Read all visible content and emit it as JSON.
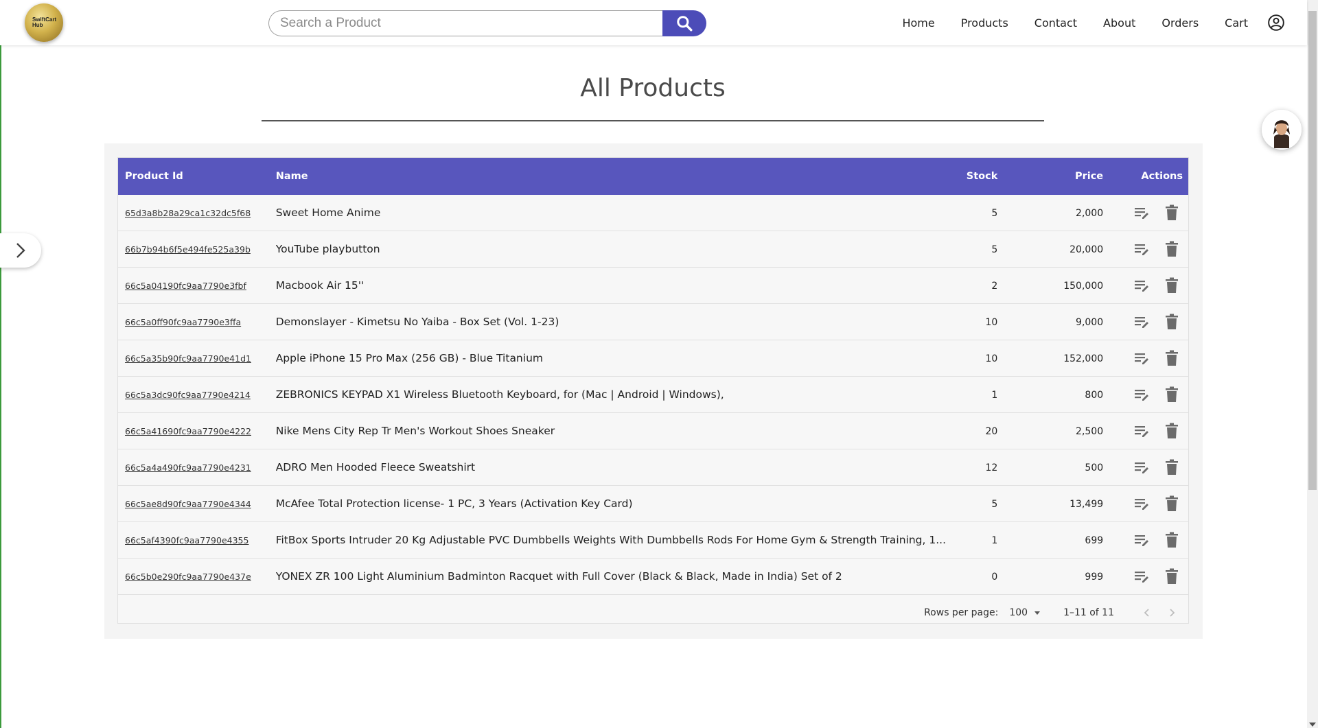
{
  "header": {
    "logo_text": "SwiftCart Hub",
    "search_placeholder": "Search a Product",
    "search_value": "",
    "nav": [
      "Home",
      "Products",
      "Contact",
      "About",
      "Orders",
      "Cart"
    ]
  },
  "page": {
    "title": "All Products"
  },
  "table": {
    "columns": {
      "id": "Product Id",
      "name": "Name",
      "stock": "Stock",
      "price": "Price",
      "actions": "Actions"
    },
    "rows": [
      {
        "id": "65d3a8b28a29ca1c32dc5f68",
        "name": "Sweet Home Anime",
        "stock": "5",
        "price": "2,000"
      },
      {
        "id": "66b7b94b6f5e494fe525a39b",
        "name": "YouTube playbutton",
        "stock": "5",
        "price": "20,000"
      },
      {
        "id": "66c5a04190fc9aa7790e3fbf",
        "name": "Macbook Air 15''",
        "stock": "2",
        "price": "150,000"
      },
      {
        "id": "66c5a0ff90fc9aa7790e3ffa",
        "name": "Demonslayer - Kimetsu No Yaiba - Box Set (Vol. 1-23)",
        "stock": "10",
        "price": "9,000"
      },
      {
        "id": "66c5a35b90fc9aa7790e41d1",
        "name": "Apple iPhone 15 Pro Max (256 GB) - Blue Titanium",
        "stock": "10",
        "price": "152,000"
      },
      {
        "id": "66c5a3dc90fc9aa7790e4214",
        "name": "ZEBRONICS KEYPAD X1 Wireless Bluetooth Keyboard, for (Mac | Android | Windows),",
        "stock": "1",
        "price": "800"
      },
      {
        "id": "66c5a41690fc9aa7790e4222",
        "name": "Nike Mens City Rep Tr Men's Workout Shoes Sneaker",
        "stock": "20",
        "price": "2,500"
      },
      {
        "id": "66c5a4a490fc9aa7790e4231",
        "name": "ADRO Men Hooded Fleece Sweatshirt",
        "stock": "12",
        "price": "500"
      },
      {
        "id": "66c5ae8d90fc9aa7790e4344",
        "name": "McAfee Total Protection license- 1 PC, 3 Years (Activation Key Card)",
        "stock": "5",
        "price": "13,499"
      },
      {
        "id": "66c5af4390fc9aa7790e4355",
        "name": "FitBox Sports Intruder 20 Kg Adjustable PVC Dumbbells Weights With Dumbbells Rods For Home Gym & Strength Training, 1...",
        "stock": "1",
        "price": "699"
      },
      {
        "id": "66c5b0e290fc9aa7790e437e",
        "name": "YONEX ZR 100 Light Aluminium Badminton Racquet with Full Cover (Black & Black, Made in India) Set of 2",
        "stock": "0",
        "price": "999"
      }
    ],
    "footer": {
      "rows_per_page_label": "Rows per page:",
      "rows_per_page_value": "100",
      "range": "1–11 of 11"
    }
  },
  "icons": {
    "search": "search-icon",
    "profile": "account-circle-icon",
    "side_toggle": "chevron-right-icon",
    "edit": "edit-note-icon",
    "delete": "trash-icon",
    "prev": "chevron-left-icon",
    "next": "chevron-right-icon"
  },
  "colors": {
    "accent": "#5856bd",
    "search_button": "#4c4cb8",
    "left_border": "#3c9a3c"
  }
}
